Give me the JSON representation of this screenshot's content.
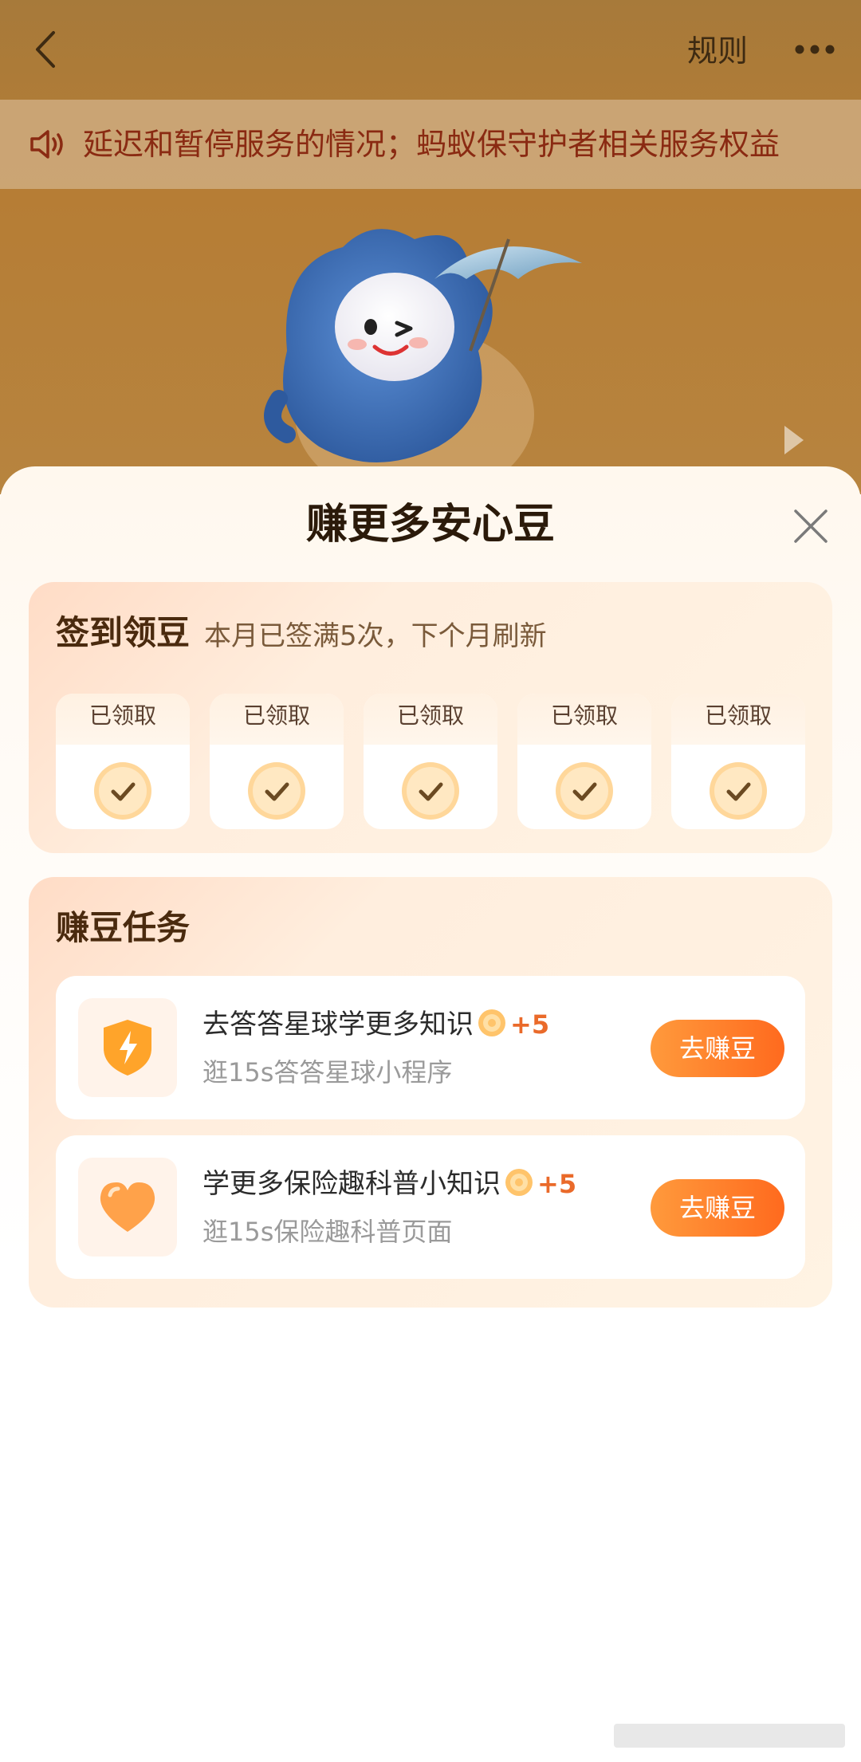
{
  "header": {
    "rules_label": "规则"
  },
  "notice": {
    "text": "延迟和暂停服务的情况；蚂蚁保守护者相关服务权益"
  },
  "sheet": {
    "title": "赚更多安心豆"
  },
  "signin": {
    "title": "签到领豆",
    "subtitle": "本月已签满5次，下个月刷新",
    "days": [
      {
        "label": "已领取"
      },
      {
        "label": "已领取"
      },
      {
        "label": "已领取"
      },
      {
        "label": "已领取"
      },
      {
        "label": "已领取"
      }
    ]
  },
  "tasks": {
    "title": "赚豆任务",
    "items": [
      {
        "title": "去答答星球学更多知识",
        "reward": "+5",
        "subtitle": "逛15s答答星球小程序",
        "button_label": "去赚豆",
        "icon": "lightning-shield-icon"
      },
      {
        "title": "学更多保险趣科普小知识",
        "reward": "+5",
        "subtitle": "逛15s保险趣科普页面",
        "button_label": "去赚豆",
        "icon": "heart-icon"
      }
    ]
  },
  "colors": {
    "accent": "#ff6a1e",
    "reward": "#ea6a2a",
    "title": "#4a2a0e"
  }
}
